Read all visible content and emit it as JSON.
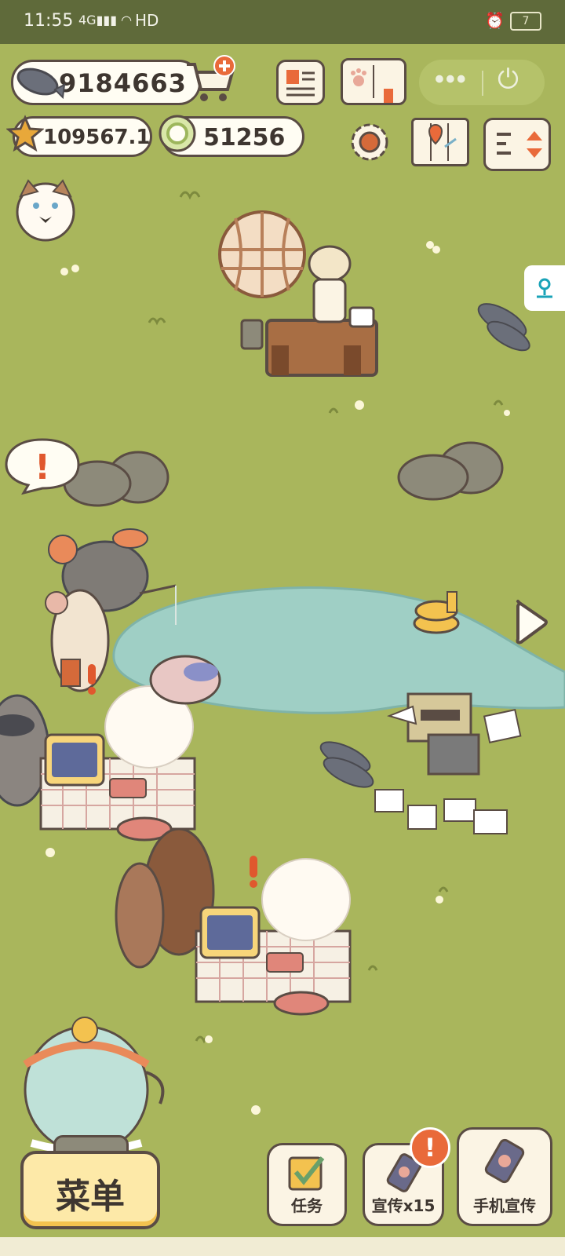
{
  "status_bar": {
    "time": "11:55",
    "network": "4G",
    "hd": "HD",
    "battery": "7"
  },
  "currency": {
    "fish": "9184663",
    "stars": "109567.1",
    "cookies": "51256"
  },
  "bubble": {
    "exclaim": "!"
  },
  "bottom_buttons": {
    "menu": "菜单",
    "tasks": "任务",
    "promote": "宣传x15",
    "phone_promote": "手机宣传"
  },
  "colors": {
    "grass": "#a9b65c",
    "pond": "#9fcfc5",
    "outline": "#5a4c44",
    "alert": "#e96a3a"
  }
}
